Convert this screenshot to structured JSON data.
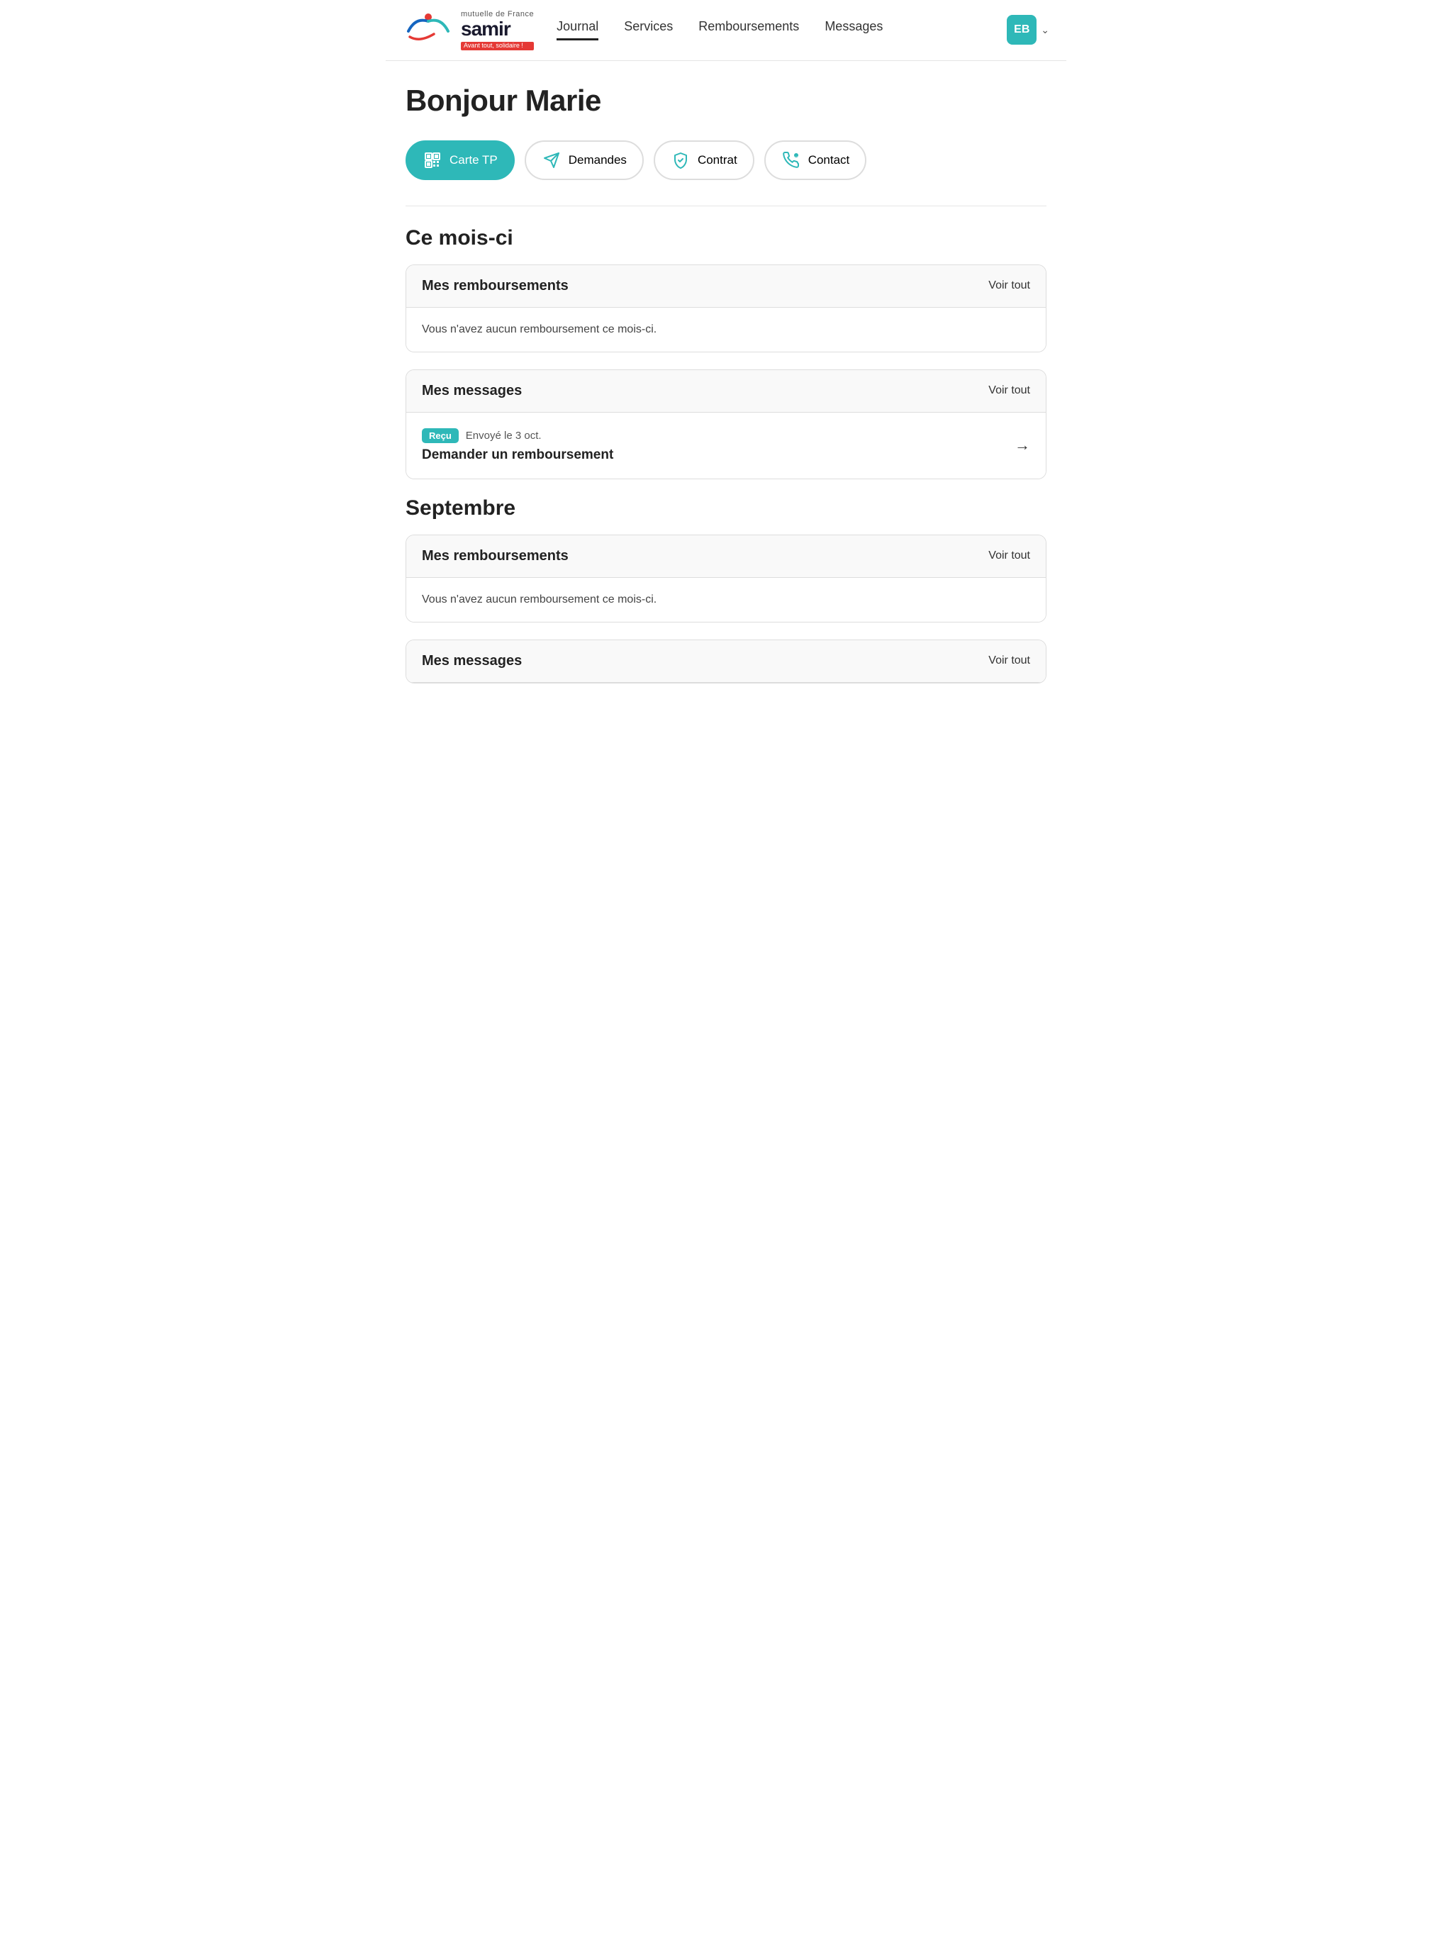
{
  "header": {
    "logo": {
      "mutuelle_label": "mutuelle de France",
      "brand_name": "samir",
      "tagline": "Avant tout, solidaire !"
    },
    "nav": {
      "items": [
        {
          "id": "journal",
          "label": "Journal",
          "active": true
        },
        {
          "id": "services",
          "label": "Services",
          "active": false
        },
        {
          "id": "remboursements",
          "label": "Remboursements",
          "active": false
        },
        {
          "id": "messages",
          "label": "Messages",
          "active": false
        }
      ]
    },
    "user": {
      "initials": "EB"
    }
  },
  "main": {
    "greeting": "Bonjour Marie",
    "quick_actions": [
      {
        "id": "carte-tp",
        "label": "Carte TP",
        "icon": "qr",
        "active": true
      },
      {
        "id": "demandes",
        "label": "Demandes",
        "icon": "paper-plane",
        "active": false
      },
      {
        "id": "contrat",
        "label": "Contrat",
        "icon": "shield-check",
        "active": false
      },
      {
        "id": "contact",
        "label": "Contact",
        "icon": "phone-chat",
        "active": false
      }
    ],
    "sections": [
      {
        "id": "ce-mois-ci",
        "title": "Ce mois-ci",
        "cards": [
          {
            "id": "remboursements-mois",
            "header_title": "Mes remboursements",
            "voir_tout_label": "Voir tout",
            "type": "empty",
            "empty_text": "Vous n'avez aucun remboursement ce mois-ci."
          },
          {
            "id": "messages-mois",
            "header_title": "Mes messages",
            "voir_tout_label": "Voir tout",
            "type": "messages",
            "messages": [
              {
                "badge": "Reçu",
                "date": "Envoyé le 3 oct.",
                "title": "Demander un remboursement"
              }
            ]
          }
        ]
      },
      {
        "id": "septembre",
        "title": "Septembre",
        "cards": [
          {
            "id": "remboursements-sept",
            "header_title": "Mes remboursements",
            "voir_tout_label": "Voir tout",
            "type": "empty",
            "empty_text": "Vous n'avez aucun remboursement ce mois-ci."
          },
          {
            "id": "messages-sept",
            "header_title": "Mes messages",
            "voir_tout_label": "Voir tout",
            "type": "empty",
            "empty_text": ""
          }
        ]
      }
    ]
  }
}
